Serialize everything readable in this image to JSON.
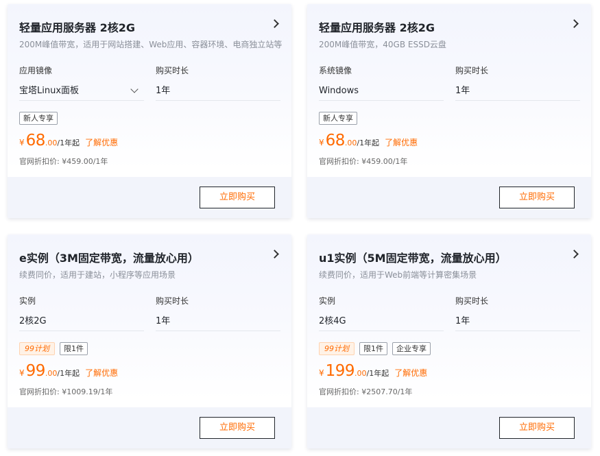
{
  "cards": [
    {
      "title": "轻量应用服务器 2核2G",
      "desc": "200M峰值带宽，适用于网站搭建、Web应用、容器环境、电商独立站等",
      "field1_label": "应用镜像",
      "field1_value": "宝塔Linux面板",
      "field2_label": "购买时长",
      "field2_value": "1年",
      "tags": [
        "新人专享"
      ],
      "currency": "¥",
      "price_int": "68",
      "price_dec": ".00",
      "price_unit": "/1年起",
      "price_link": "了解优惠",
      "original_price": "官网折扣价: ¥459.00/1年",
      "buy_label": "立即购买"
    },
    {
      "title": "轻量应用服务器 2核2G",
      "desc": "200M峰值带宽，40GB ESSD云盘",
      "field1_label": "系统镜像",
      "field1_value": "Windows",
      "field2_label": "购买时长",
      "field2_value": "1年",
      "tags": [
        "新人专享"
      ],
      "currency": "¥",
      "price_int": "68",
      "price_dec": ".00",
      "price_unit": "/1年起",
      "price_link": "了解优惠",
      "original_price": "官网折扣价: ¥459.00/1年",
      "buy_label": "立即购买"
    },
    {
      "title": "e实例（3M固定带宽，流量放心用）",
      "desc": "续费同价，适用于建站，小程序等应用场景",
      "field1_label": "实例",
      "field1_value": "2核2G",
      "field2_label": "购买时长",
      "field2_value": "1年",
      "plan_tag": "99计划",
      "tags": [
        "限1件"
      ],
      "currency": "¥",
      "price_int": "99",
      "price_dec": ".00",
      "price_unit": "/1年起",
      "price_link": "了解优惠",
      "original_price": "官网折扣价: ¥1009.19/1年",
      "buy_label": "立即购买"
    },
    {
      "title": "u1实例（5M固定带宽，流量放心用）",
      "desc": "续费同价，适用于Web前端等计算密集场景",
      "field1_label": "实例",
      "field1_value": "2核4G",
      "field2_label": "购买时长",
      "field2_value": "1年",
      "plan_tag": "99计划",
      "tags": [
        "限1件",
        "企业专享"
      ],
      "currency": "¥",
      "price_int": "199",
      "price_dec": ".00",
      "price_unit": "/1年起",
      "price_link": "了解优惠",
      "original_price": "官网折扣价: ¥2507.70/1年",
      "buy_label": "立即购买"
    }
  ],
  "colors": {
    "accent": "#ff6a00",
    "card_gradient_top": "#f3f5fd",
    "footer_bg": "#f2f4fb"
  },
  "icons": {
    "arrow": "chevron-right-icon",
    "dropdown": "chevron-down-icon"
  }
}
